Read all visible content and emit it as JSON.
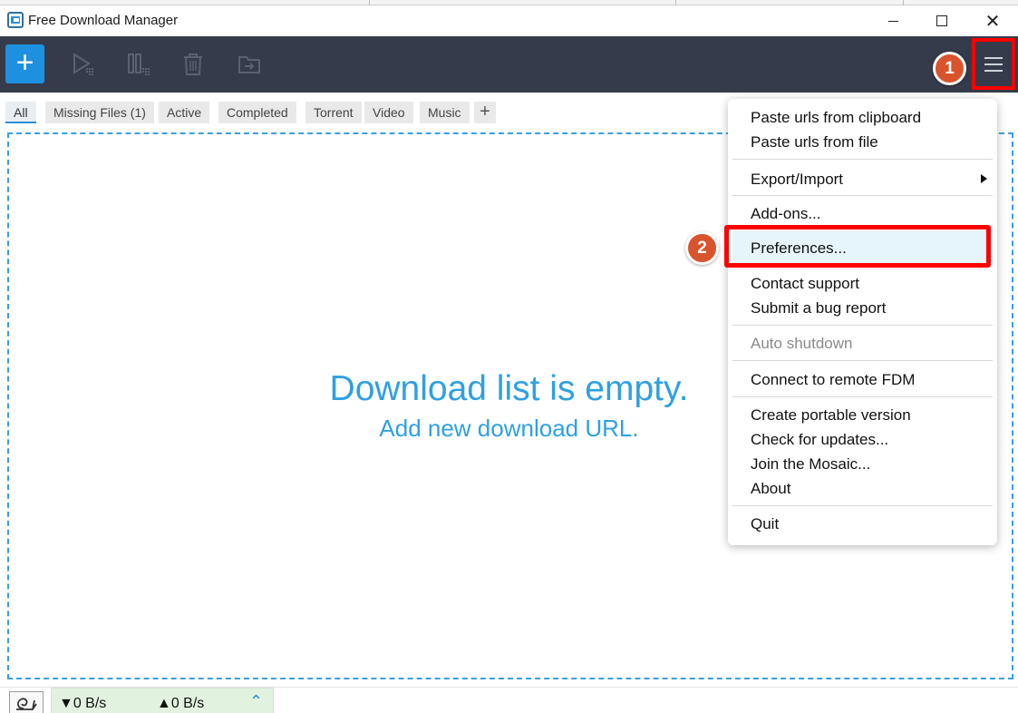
{
  "window": {
    "title": "Free Download Manager",
    "controls": {
      "minimize": "minimize",
      "maximize": "maximize",
      "close": "✕"
    }
  },
  "toolbar": {
    "add_label": "+",
    "icons": [
      "play-icon",
      "pause-icon",
      "trash-icon",
      "move-folder-icon",
      "hamburger-menu-icon"
    ]
  },
  "annotations": {
    "step1": "1",
    "step2": "2"
  },
  "tabs": {
    "items": [
      "All",
      "Missing Files (1)",
      "Active",
      "Completed",
      "Torrent",
      "Video",
      "Music"
    ],
    "active": "All",
    "add_label": "+"
  },
  "empty_state": {
    "title": "Download list is empty.",
    "subtitle": "Add new download URL."
  },
  "status": {
    "down": "▼0 B/s",
    "up": "▲0 B/s",
    "toggle": "⌃"
  },
  "menu": {
    "items": [
      "Paste urls from clipboard",
      "Paste urls from file",
      "Export/Import",
      "Add-ons...",
      "Preferences...",
      "Contact support",
      "Submit a bug report",
      "Auto shutdown",
      "Connect to remote FDM",
      "Create portable version",
      "Check for updates...",
      "Join the Mosaic...",
      "About",
      "Quit"
    ],
    "disabled": [
      "Auto shutdown"
    ],
    "highlighted": "Preferences..."
  },
  "colors": {
    "toolbar_bg": "#353b4a",
    "accent": "#1e90e0",
    "empty_text": "#2fa0e0",
    "annotation_red": "#ff0000",
    "badge": "#d9532c"
  }
}
